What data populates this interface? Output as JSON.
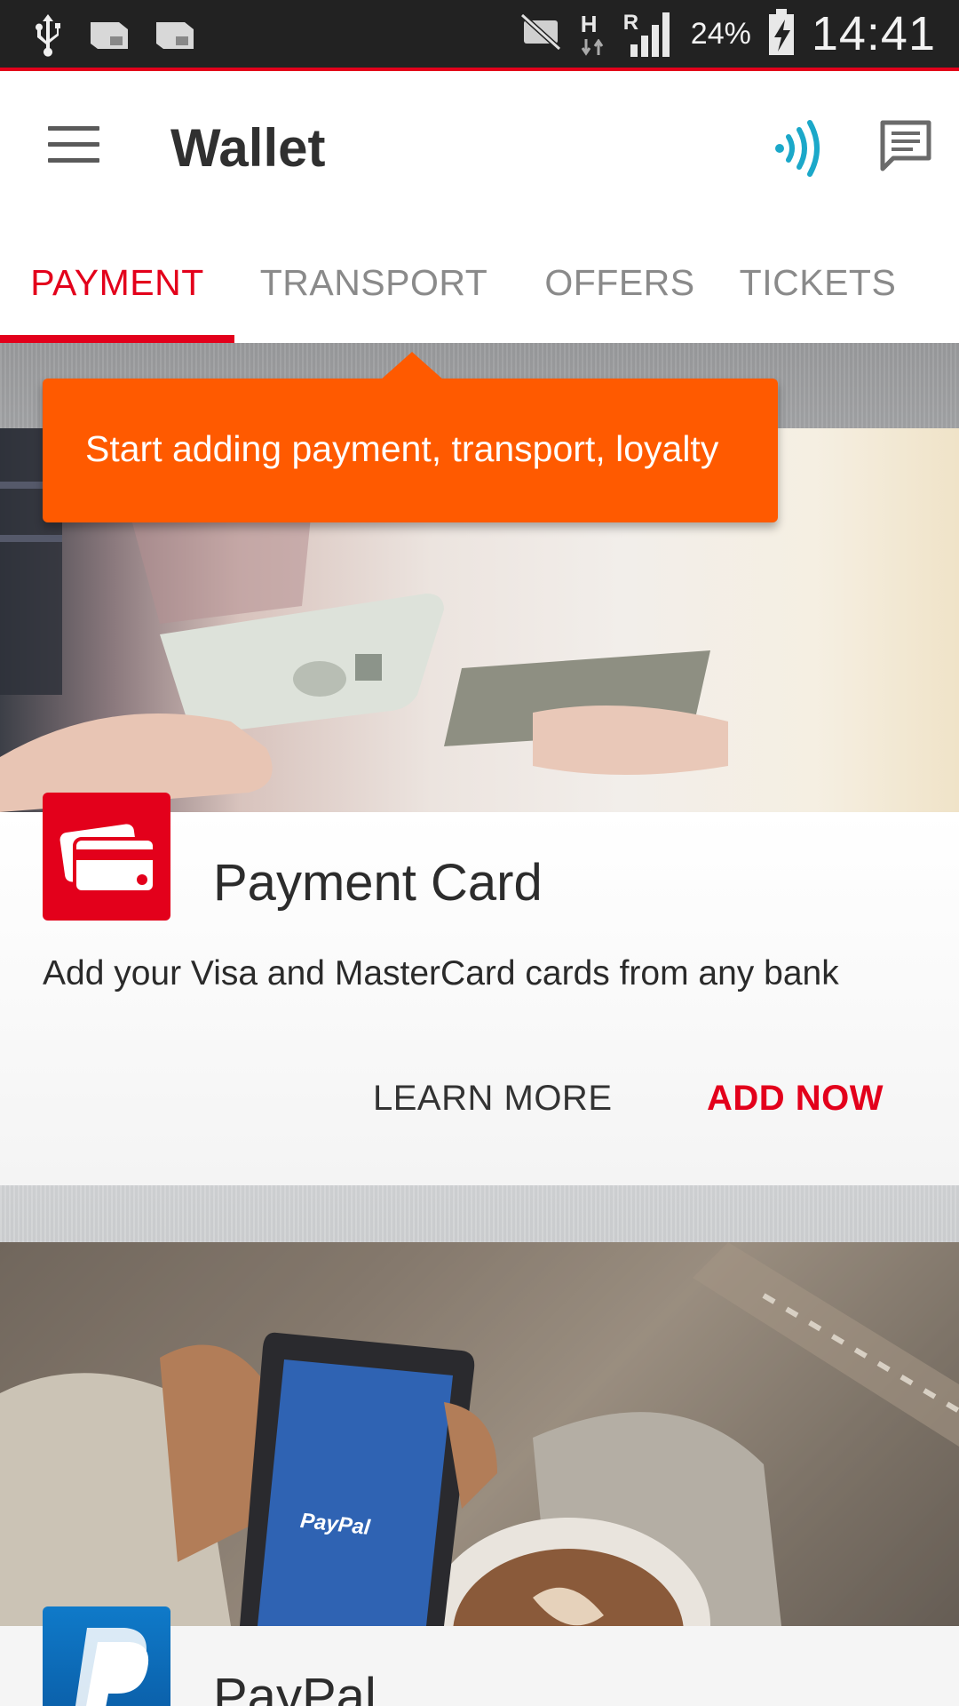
{
  "status_bar": {
    "battery_percent": "24%",
    "time": "14:41",
    "network_type": "H",
    "roaming": "R",
    "icons": [
      "usb-icon",
      "sim-card-icon",
      "sim-card-icon",
      "muted-icon",
      "signal-icon",
      "battery-charging-icon"
    ]
  },
  "app_bar": {
    "title": "Wallet",
    "icons": [
      "menu-icon",
      "nfc-icon",
      "message-icon"
    ]
  },
  "tabs": [
    {
      "label": "PAYMENT",
      "active": true
    },
    {
      "label": "TRANSPORT",
      "active": false
    },
    {
      "label": "OFFERS",
      "active": false
    },
    {
      "label": "TICKETS",
      "active": false
    }
  ],
  "tooltip": {
    "text": "Start adding payment, transport, loyalty"
  },
  "cards": [
    {
      "title": "Payment Card",
      "description": "Add your Visa and MasterCard cards from any bank",
      "learn_more_label": "LEARN MORE",
      "add_now_label": "ADD NOW",
      "icon": "payment-card-icon"
    },
    {
      "title": "PayPal",
      "photo_text": "PayPal",
      "icon": "paypal-icon"
    }
  ],
  "colors": {
    "accent": "#e3001b",
    "tooltip": "#ff5a00",
    "nfc": "#1ba8c9",
    "status_bar": "#222222"
  }
}
